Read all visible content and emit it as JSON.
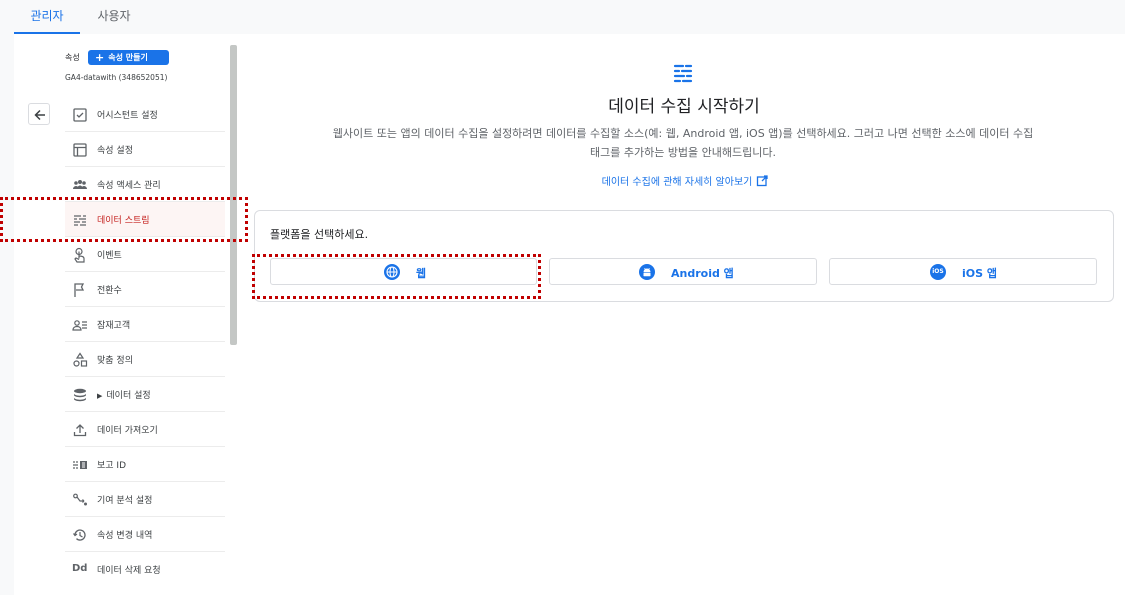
{
  "tabs": [
    "관리자",
    "사용자"
  ],
  "property": {
    "label": "속성",
    "create_button": "속성 만들기",
    "id_text": "GA4-datawith (348652051)"
  },
  "nav": [
    {
      "label": "어시스턴트 설정",
      "icon": "checkbox-icon"
    },
    {
      "label": "속성 설정",
      "icon": "window-icon"
    },
    {
      "label": "속성 액세스 관리",
      "icon": "people-icon"
    },
    {
      "label": "데이터 스트림",
      "icon": "data-stream-icon"
    },
    {
      "label": "이벤트",
      "icon": "touch-icon"
    },
    {
      "label": "전환수",
      "icon": "flag-icon"
    },
    {
      "label": "잠재고객",
      "icon": "audience-icon"
    },
    {
      "label": "맞춤 정의",
      "icon": "shapes-icon"
    },
    {
      "label": "데이터 설정",
      "icon": "database-icon"
    },
    {
      "label": "데이터 가져오기",
      "icon": "upload-icon"
    },
    {
      "label": "보고 ID",
      "icon": "report-id-icon"
    },
    {
      "label": "기여 분석 설정",
      "icon": "attribution-icon"
    },
    {
      "label": "속성 변경 내역",
      "icon": "history-icon"
    },
    {
      "label": "데이터 삭제 요청",
      "icon": "deletion-icon"
    }
  ],
  "nav_icon_text": {
    "deletion": "Dd"
  },
  "main": {
    "title": "데이터 수집 시작하기",
    "desc_line1": "웹사이트 또는 앱의 데이터 수집을 설정하려면 데이터를 수집할 소스(예: 웹, Android 앱, iOS 앱)를 선택하세요. 그러고 나면 선택한 소스에 데이터 수집",
    "desc_line2": "태그를 추가하는 방법을 안내해드립니다.",
    "learn_link": "데이터 수집에 관해 자세히 알아보기",
    "platform_prompt": "플랫폼을 선택하세요.",
    "platforms": [
      "웹",
      "Android 앱",
      "iOS 앱"
    ],
    "ios_icon_text": "iOS"
  },
  "colors": {
    "accent": "#1a73e8",
    "active_red": "#c5221f",
    "highlight": "#c00000"
  }
}
